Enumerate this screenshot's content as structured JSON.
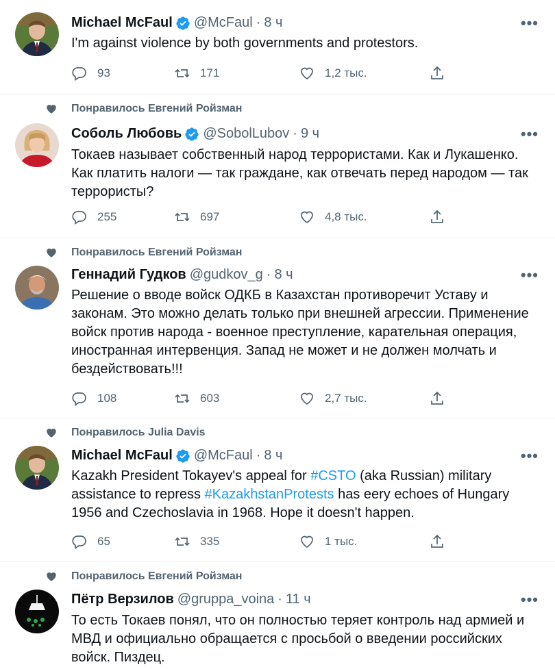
{
  "tweets": [
    {
      "name": "Michael McFaul",
      "handle": "@McFaul",
      "time": "8 ч",
      "social": "",
      "text": "I'm against violence by both governments and protestors.",
      "replies": "93",
      "retweets": "171",
      "likes": "1,2 тыс."
    },
    {
      "name": "Соболь Любовь",
      "handle": "@SobolLubov",
      "time": "9 ч",
      "social": "Понравилось Евгений Ройзман",
      "text": "Токаев называет собственный народ террористами. Как и Лукашенко. Как платить налоги — так граждане, как отвечать перед народом — так террористы?",
      "replies": "255",
      "retweets": "697",
      "likes": "4,8 тыс."
    },
    {
      "name": "Геннадий Гудков",
      "handle": "@gudkov_g",
      "time": "8 ч",
      "social": "Понравилось Евгений Ройзман",
      "text": "Решение о вводе войск ОДКБ в Казахстан противоречит Уставу и законам. Это можно делать только при внешней агрессии. Применение войск против народа - военное преступление, карательная операция, иностранная интервенция. Запад не может и не должен молчать и бездействовать!!!",
      "replies": "108",
      "retweets": "603",
      "likes": "2,7 тыс."
    },
    {
      "name": "Michael McFaul",
      "handle": "@McFaul",
      "time": "8 ч",
      "social": "Понравилось Julia Davis",
      "text_parts": [
        "Kazakh President Tokayev's appeal for ",
        "#CSTO",
        " (aka Russian) military assistance to repress ",
        "#KazakhstanProtests",
        " has eery echoes of Hungary 1956 and Czechoslavia in 1968. Hope it doesn't happen."
      ],
      "replies": "65",
      "retweets": "335",
      "likes": "1 тыс."
    },
    {
      "name": "Пётр Верзилов",
      "handle": "@gruppa_voina",
      "time": "11 ч",
      "social": "Понравилось Евгений Ройзман",
      "text": "То есть Токаев понял, что он полностью теряет контроль над армией и МВД и официально обращается с просьбой о введении российских войск. Пиздец."
    }
  ],
  "dot": "·",
  "more_glyph": "•••",
  "colors": {
    "accent": "#1d9bf0",
    "muted": "#536471",
    "text": "#0f1419",
    "divider": "#eff3f4"
  },
  "icons": [
    "heart-icon",
    "verified-badge-icon",
    "reply-icon",
    "retweet-icon",
    "like-icon",
    "share-icon",
    "more-icon"
  ]
}
